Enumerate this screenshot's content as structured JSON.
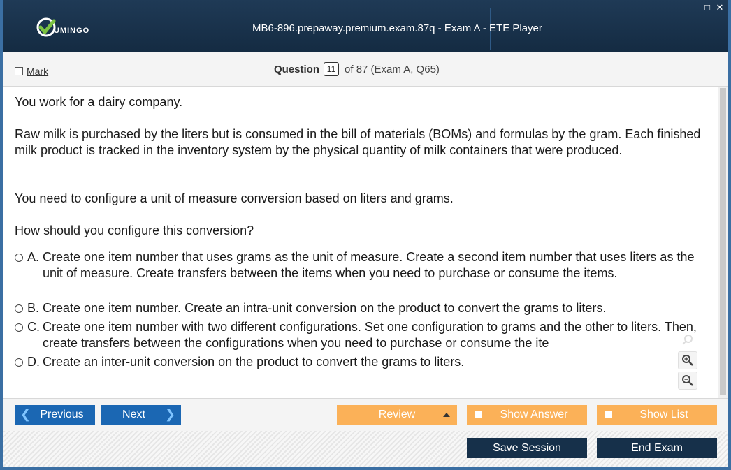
{
  "window": {
    "title": "MB6-896.prepaway.premium.exam.87q - Exam A - ETE Player",
    "logo_text": "UMINGO",
    "controls": {
      "minimize": "–",
      "maximize": "□",
      "close": "✕"
    }
  },
  "question_bar": {
    "mark_label": "Mark",
    "question_label": "Question",
    "current_number": "11",
    "of_text": "of 87 (Exam A, Q65)"
  },
  "question": {
    "paragraphs": [
      "You work for a dairy company.",
      "Raw milk is purchased by the liters but is consumed in the bill of materials (BOMs) and formulas by the gram. Each finished milk product is tracked in the inventory system by the physical quantity of milk containers that were produced.",
      "You need to configure a unit of measure conversion based on liters and grams.",
      "How should you configure this conversion?"
    ],
    "options": [
      {
        "letter": "A.",
        "text": "Create one item number that uses grams as the unit of measure. Create a second item number that uses liters as the unit of measure. Create transfers between the items when you need to purchase or consume the items."
      },
      {
        "letter": "B.",
        "text": "Create one item number. Create an intra-unit conversion on the product to convert the grams to liters."
      },
      {
        "letter": "C.",
        "text": "Create one item number with two different configurations. Set one configuration to grams and the other to liters. Then, create transfers between the configurations when you need to purchase or consume the ite"
      },
      {
        "letter": "D.",
        "text": "Create an inter-unit conversion on the product to convert the grams to liters."
      }
    ]
  },
  "zoom": {
    "icons": [
      "search-icon",
      "zoom-in-icon",
      "zoom-out-icon"
    ]
  },
  "bottom_bar": {
    "previous_label": "Previous",
    "next_label": "Next",
    "review_label": "Review",
    "show_answer_label": "Show Answer",
    "show_list_label": "Show List",
    "save_session_label": "Save Session",
    "end_exam_label": "End Exam"
  },
  "colors": {
    "titlebar": "#1f3a56",
    "nav_blue": "#1b67b3",
    "toggle_orange": "#fbb158",
    "action_dark": "#16304a",
    "logo_green": "#7cc242"
  }
}
